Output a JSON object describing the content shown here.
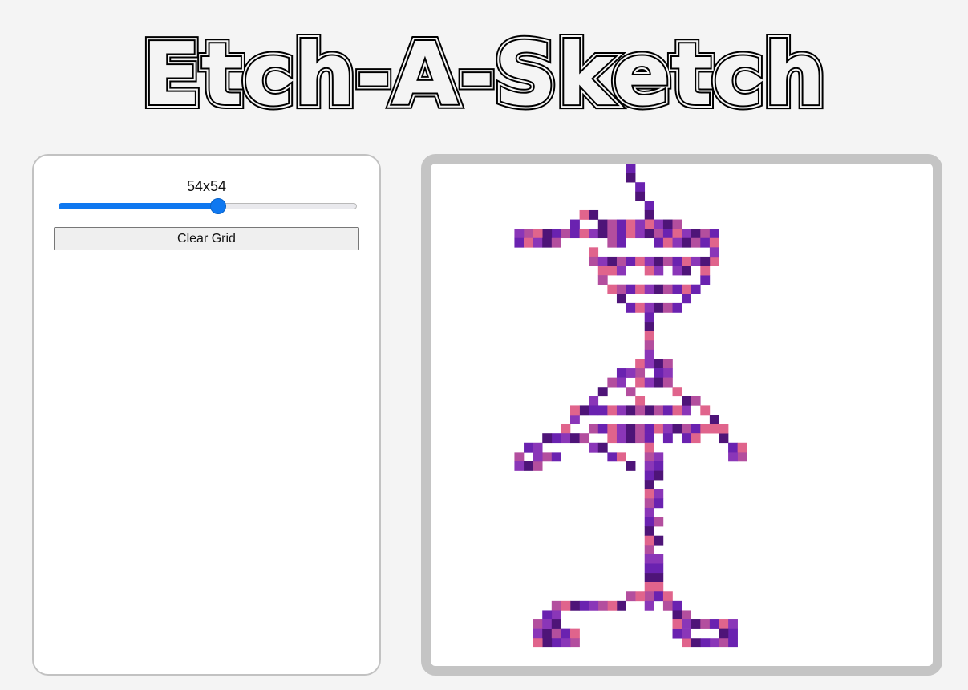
{
  "header": {
    "title": "Etch-A-Sketch"
  },
  "controls": {
    "grid_size_label": "54x54",
    "slider": {
      "min": 1,
      "max": 100,
      "value": 54
    },
    "clear_label": "Clear Grid",
    "accent_color": "#0f78f0"
  },
  "grid": {
    "rows": 54,
    "cols": 54,
    "background": "#ffffff",
    "palette": [
      "#4e1478",
      "#6a22b0",
      "#8a36b8",
      "#b34e9e",
      "#e0648c"
    ],
    "strokes": [
      [
        [
          23,
          0
        ],
        [
          23,
          1
        ],
        [
          24,
          2
        ],
        [
          24,
          3
        ],
        [
          25,
          4
        ],
        [
          25,
          5
        ],
        [
          25,
          6
        ]
      ],
      [
        [
          19,
          5
        ],
        [
          18,
          5
        ],
        [
          17,
          6
        ],
        [
          15,
          7
        ],
        [
          14,
          7
        ],
        [
          13,
          7
        ],
        [
          12,
          7
        ],
        [
          11,
          7
        ],
        [
          11,
          8
        ],
        [
          12,
          8
        ],
        [
          13,
          8
        ],
        [
          14,
          8
        ],
        [
          15,
          8
        ],
        [
          16,
          7
        ],
        [
          17,
          7
        ],
        [
          18,
          7
        ],
        [
          19,
          7
        ],
        [
          20,
          7
        ],
        [
          21,
          7
        ],
        [
          22,
          7
        ],
        [
          23,
          7
        ],
        [
          24,
          7
        ],
        [
          25,
          7
        ],
        [
          26,
          7
        ],
        [
          27,
          7
        ],
        [
          28,
          7
        ],
        [
          29,
          7
        ],
        [
          30,
          7
        ],
        [
          31,
          7
        ],
        [
          32,
          7
        ]
      ],
      [
        [
          20,
          6
        ],
        [
          21,
          6
        ],
        [
          22,
          6
        ],
        [
          23,
          6
        ],
        [
          24,
          6
        ],
        [
          25,
          6
        ],
        [
          26,
          6
        ],
        [
          27,
          6
        ],
        [
          28,
          6
        ]
      ],
      [
        [
          26,
          8
        ],
        [
          27,
          8
        ],
        [
          28,
          8
        ],
        [
          29,
          8
        ],
        [
          30,
          8
        ],
        [
          31,
          8
        ],
        [
          32,
          8
        ],
        [
          21,
          8
        ],
        [
          22,
          8
        ]
      ],
      [
        [
          19,
          9
        ],
        [
          19,
          10
        ],
        [
          20,
          11
        ],
        [
          20,
          12
        ],
        [
          21,
          13
        ],
        [
          22,
          14
        ],
        [
          23,
          15
        ],
        [
          24,
          15
        ],
        [
          25,
          15
        ],
        [
          26,
          15
        ],
        [
          27,
          15
        ],
        [
          28,
          15
        ],
        [
          29,
          14
        ],
        [
          30,
          13
        ],
        [
          31,
          12
        ],
        [
          31,
          11
        ],
        [
          32,
          10
        ],
        [
          32,
          9
        ]
      ],
      [
        [
          20,
          10
        ],
        [
          21,
          10
        ],
        [
          22,
          10
        ],
        [
          23,
          10
        ],
        [
          24,
          10
        ],
        [
          25,
          10
        ],
        [
          26,
          10
        ],
        [
          27,
          10
        ],
        [
          28,
          10
        ],
        [
          29,
          10
        ],
        [
          30,
          10
        ],
        [
          31,
          10
        ]
      ],
      [
        [
          21,
          11
        ],
        [
          22,
          11
        ],
        [
          25,
          11
        ],
        [
          26,
          11
        ],
        [
          28,
          11
        ],
        [
          29,
          11
        ]
      ],
      [
        [
          21,
          13
        ],
        [
          22,
          13
        ],
        [
          23,
          13
        ],
        [
          24,
          13
        ],
        [
          25,
          13
        ],
        [
          26,
          13
        ],
        [
          27,
          13
        ],
        [
          28,
          13
        ],
        [
          29,
          13
        ]
      ],
      [
        [
          25,
          16
        ],
        [
          25,
          17
        ],
        [
          25,
          18
        ],
        [
          25,
          19
        ],
        [
          25,
          20
        ]
      ],
      [
        [
          24,
          21
        ],
        [
          25,
          21
        ],
        [
          26,
          21
        ],
        [
          27,
          21
        ],
        [
          27,
          22
        ],
        [
          26,
          22
        ],
        [
          24,
          22
        ],
        [
          23,
          22
        ],
        [
          22,
          22
        ],
        [
          21,
          23
        ],
        [
          20,
          24
        ],
        [
          19,
          25
        ],
        [
          19,
          26
        ],
        [
          18,
          26
        ],
        [
          17,
          27
        ],
        [
          16,
          28
        ],
        [
          15,
          29
        ],
        [
          14,
          29
        ],
        [
          13,
          30
        ],
        [
          12,
          30
        ],
        [
          11,
          31
        ],
        [
          11,
          32
        ],
        [
          12,
          32
        ],
        [
          13,
          32
        ],
        [
          14,
          31
        ],
        [
          15,
          31
        ]
      ],
      [
        [
          22,
          23
        ],
        [
          23,
          24
        ],
        [
          24,
          25
        ],
        [
          25,
          26
        ],
        [
          26,
          26
        ],
        [
          27,
          26
        ],
        [
          28,
          26
        ],
        [
          29,
          26
        ]
      ],
      [
        [
          24,
          23
        ],
        [
          25,
          23
        ],
        [
          26,
          23
        ],
        [
          27,
          23
        ],
        [
          28,
          24
        ],
        [
          29,
          25
        ],
        [
          30,
          25
        ],
        [
          31,
          26
        ],
        [
          32,
          27
        ],
        [
          32,
          28
        ],
        [
          33,
          29
        ],
        [
          34,
          30
        ],
        [
          35,
          30
        ],
        [
          35,
          31
        ],
        [
          34,
          31
        ]
      ],
      [
        [
          17,
          26
        ],
        [
          18,
          26
        ],
        [
          19,
          26
        ],
        [
          20,
          26
        ],
        [
          21,
          26
        ],
        [
          22,
          26
        ],
        [
          23,
          26
        ],
        [
          24,
          26
        ],
        [
          25,
          26
        ]
      ],
      [
        [
          15,
          29
        ],
        [
          16,
          29
        ],
        [
          17,
          29
        ],
        [
          18,
          29
        ],
        [
          19,
          28
        ],
        [
          20,
          28
        ],
        [
          21,
          28
        ],
        [
          22,
          28
        ],
        [
          23,
          28
        ],
        [
          24,
          28
        ],
        [
          25,
          28
        ],
        [
          26,
          28
        ],
        [
          27,
          28
        ],
        [
          28,
          28
        ],
        [
          29,
          28
        ],
        [
          30,
          28
        ],
        [
          31,
          28
        ],
        [
          32,
          28
        ],
        [
          33,
          28
        ]
      ],
      [
        [
          21,
          29
        ],
        [
          22,
          29
        ],
        [
          23,
          29
        ],
        [
          24,
          29
        ],
        [
          25,
          29
        ],
        [
          27,
          29
        ],
        [
          29,
          29
        ],
        [
          30,
          29
        ]
      ],
      [
        [
          13,
          31
        ],
        [
          14,
          31
        ],
        [
          19,
          30
        ],
        [
          20,
          30
        ],
        [
          21,
          31
        ],
        [
          22,
          31
        ],
        [
          23,
          32
        ]
      ],
      [
        [
          25,
          30
        ],
        [
          25,
          31
        ],
        [
          25,
          32
        ],
        [
          25,
          33
        ],
        [
          25,
          34
        ],
        [
          25,
          35
        ],
        [
          25,
          36
        ],
        [
          25,
          37
        ],
        [
          25,
          38
        ],
        [
          25,
          39
        ],
        [
          25,
          40
        ],
        [
          25,
          41
        ],
        [
          25,
          42
        ],
        [
          25,
          43
        ],
        [
          25,
          44
        ],
        [
          25,
          45
        ],
        [
          25,
          46
        ],
        [
          25,
          47
        ]
      ],
      [
        [
          26,
          31
        ],
        [
          26,
          32
        ],
        [
          26,
          33
        ],
        [
          26,
          35
        ],
        [
          26,
          36
        ],
        [
          26,
          38
        ],
        [
          26,
          40
        ],
        [
          26,
          42
        ],
        [
          26,
          43
        ],
        [
          26,
          44
        ],
        [
          26,
          45
        ]
      ],
      [
        [
          24,
          46
        ],
        [
          23,
          46
        ],
        [
          22,
          47
        ],
        [
          21,
          47
        ],
        [
          20,
          47
        ],
        [
          19,
          47
        ],
        [
          18,
          47
        ],
        [
          17,
          47
        ],
        [
          16,
          47
        ],
        [
          15,
          47
        ],
        [
          15,
          48
        ],
        [
          14,
          48
        ],
        [
          13,
          49
        ],
        [
          13,
          50
        ],
        [
          14,
          50
        ],
        [
          15,
          50
        ],
        [
          16,
          50
        ],
        [
          17,
          50
        ],
        [
          17,
          51
        ],
        [
          16,
          51
        ],
        [
          15,
          51
        ],
        [
          14,
          51
        ],
        [
          13,
          51
        ],
        [
          13,
          50
        ]
      ],
      [
        [
          25,
          46
        ],
        [
          26,
          46
        ],
        [
          27,
          46
        ],
        [
          27,
          47
        ],
        [
          28,
          47
        ],
        [
          28,
          48
        ],
        [
          29,
          48
        ],
        [
          29,
          49
        ],
        [
          30,
          49
        ],
        [
          31,
          49
        ],
        [
          32,
          49
        ],
        [
          33,
          49
        ],
        [
          34,
          49
        ],
        [
          34,
          50
        ],
        [
          33,
          50
        ],
        [
          32,
          51
        ],
        [
          31,
          51
        ],
        [
          30,
          51
        ],
        [
          29,
          51
        ],
        [
          29,
          50
        ],
        [
          28,
          50
        ],
        [
          28,
          49
        ]
      ],
      [
        [
          14,
          49
        ],
        [
          15,
          49
        ],
        [
          14,
          50
        ]
      ],
      [
        [
          33,
          51
        ],
        [
          34,
          51
        ]
      ]
    ]
  }
}
